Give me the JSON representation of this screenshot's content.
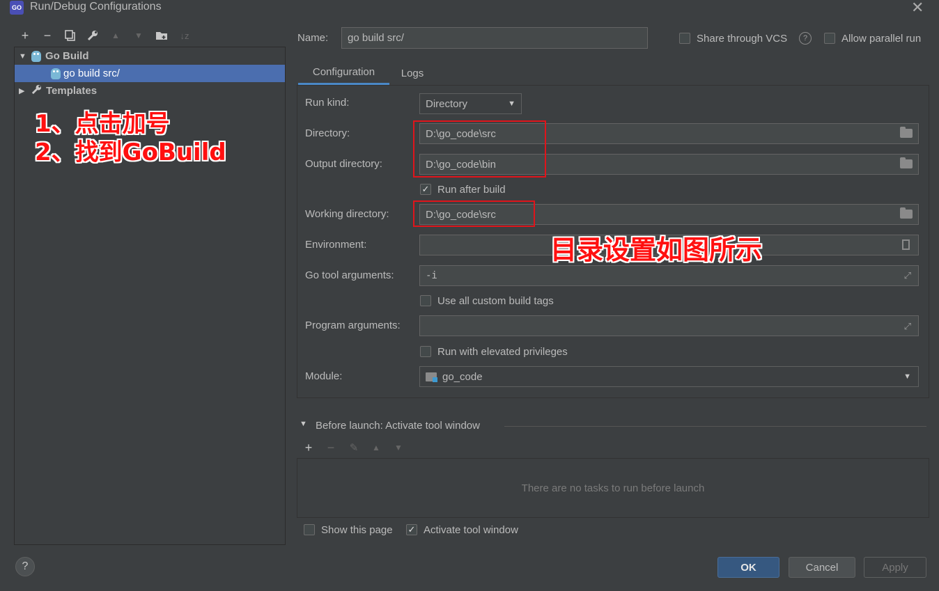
{
  "window": {
    "title": "Run/Debug Configurations",
    "app_icon": "GO"
  },
  "toolbar": {
    "icons": [
      "add-icon",
      "remove-icon",
      "copy-icon",
      "wrench-icon",
      "move-up-icon",
      "move-down-icon",
      "folder-add-icon",
      "sort-icon"
    ]
  },
  "tree": {
    "group": "Go Build",
    "item": "go build src/",
    "templates": "Templates"
  },
  "annotations": {
    "left_line1": "1、点击加号",
    "left_line2": "2、找到GoBuild",
    "right": "目录设置如图所示"
  },
  "header": {
    "name_label": "Name:",
    "name_value": "go build src/",
    "share_vcs": "Share through VCS",
    "allow_parallel": "Allow parallel run"
  },
  "tabs": [
    "Configuration",
    "Logs"
  ],
  "form": {
    "run_kind_label": "Run kind:",
    "run_kind_value": "Directory",
    "directory_label": "Directory:",
    "directory_value": "D:\\go_code\\src",
    "output_label": "Output directory:",
    "output_value": "D:\\go_code\\bin",
    "run_after_build": "Run after build",
    "working_label": "Working directory:",
    "working_value": "D:\\go_code\\src",
    "env_label": "Environment:",
    "env_value": "",
    "go_tool_label": "Go tool arguments:",
    "go_tool_value": "-i",
    "custom_tags": "Use all custom build tags",
    "program_args_label": "Program arguments:",
    "program_args_value": "",
    "elevated": "Run with elevated privileges",
    "module_label": "Module:",
    "module_value": "go_code"
  },
  "before_launch": {
    "title": "Before launch: Activate tool window",
    "empty": "There are no tasks to run before launch"
  },
  "footer": {
    "show_page": "Show this page",
    "activate_tool": "Activate tool window",
    "help": "?",
    "ok": "OK",
    "cancel": "Cancel",
    "apply": "Apply"
  },
  "colors": {
    "background": "#3c3f41",
    "selection": "#4b6eaf",
    "annotation_red": "#e0141b",
    "ok_button": "#365880"
  }
}
